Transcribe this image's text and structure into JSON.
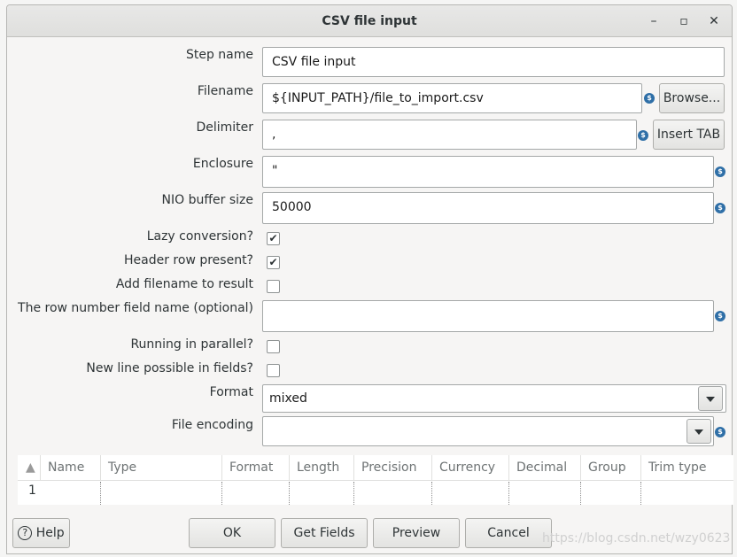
{
  "window": {
    "title": "CSV file input",
    "min_icon": "minimize-icon",
    "max_icon": "maximize-icon",
    "close_icon": "close-icon"
  },
  "fields": {
    "step_name": {
      "label": "Step name",
      "value": "CSV file input"
    },
    "filename": {
      "label": "Filename",
      "value": "${INPUT_PATH}/file_to_import.csv",
      "button": "Browse..."
    },
    "delimiter": {
      "label": "Delimiter",
      "value": ",",
      "button": "Insert TAB"
    },
    "enclosure": {
      "label": "Enclosure",
      "value": "\""
    },
    "nio_buffer": {
      "label": "NIO buffer size",
      "value": "50000"
    },
    "lazy_conversion": {
      "label": "Lazy conversion?",
      "checked": true
    },
    "header_row": {
      "label": "Header row present?",
      "checked": true
    },
    "add_filename": {
      "label": "Add filename to result",
      "checked": false
    },
    "row_number_field": {
      "label": "The row number field name (optional)",
      "value": ""
    },
    "running_parallel": {
      "label": "Running in parallel?",
      "checked": false
    },
    "new_line": {
      "label": "New line possible in fields?",
      "checked": false
    },
    "format": {
      "label": "Format",
      "value": "mixed"
    },
    "file_encoding": {
      "label": "File encoding",
      "value": ""
    }
  },
  "variable_icon": "$",
  "check_mark": "✔",
  "grid": {
    "sort_icon": "sort-up-icon",
    "columns": [
      "Name",
      "Type",
      "Format",
      "Length",
      "Precision",
      "Currency",
      "Decimal",
      "Group",
      "Trim type"
    ],
    "rows": [
      "1"
    ]
  },
  "buttons": {
    "help": "Help",
    "ok": "OK",
    "get_fields": "Get Fields",
    "preview": "Preview",
    "cancel": "Cancel"
  },
  "watermark": "https://blog.csdn.net/wzy0623",
  "colors": {
    "variable_icon": "#2f6fa7",
    "titlebar": "#e3e3e1"
  }
}
